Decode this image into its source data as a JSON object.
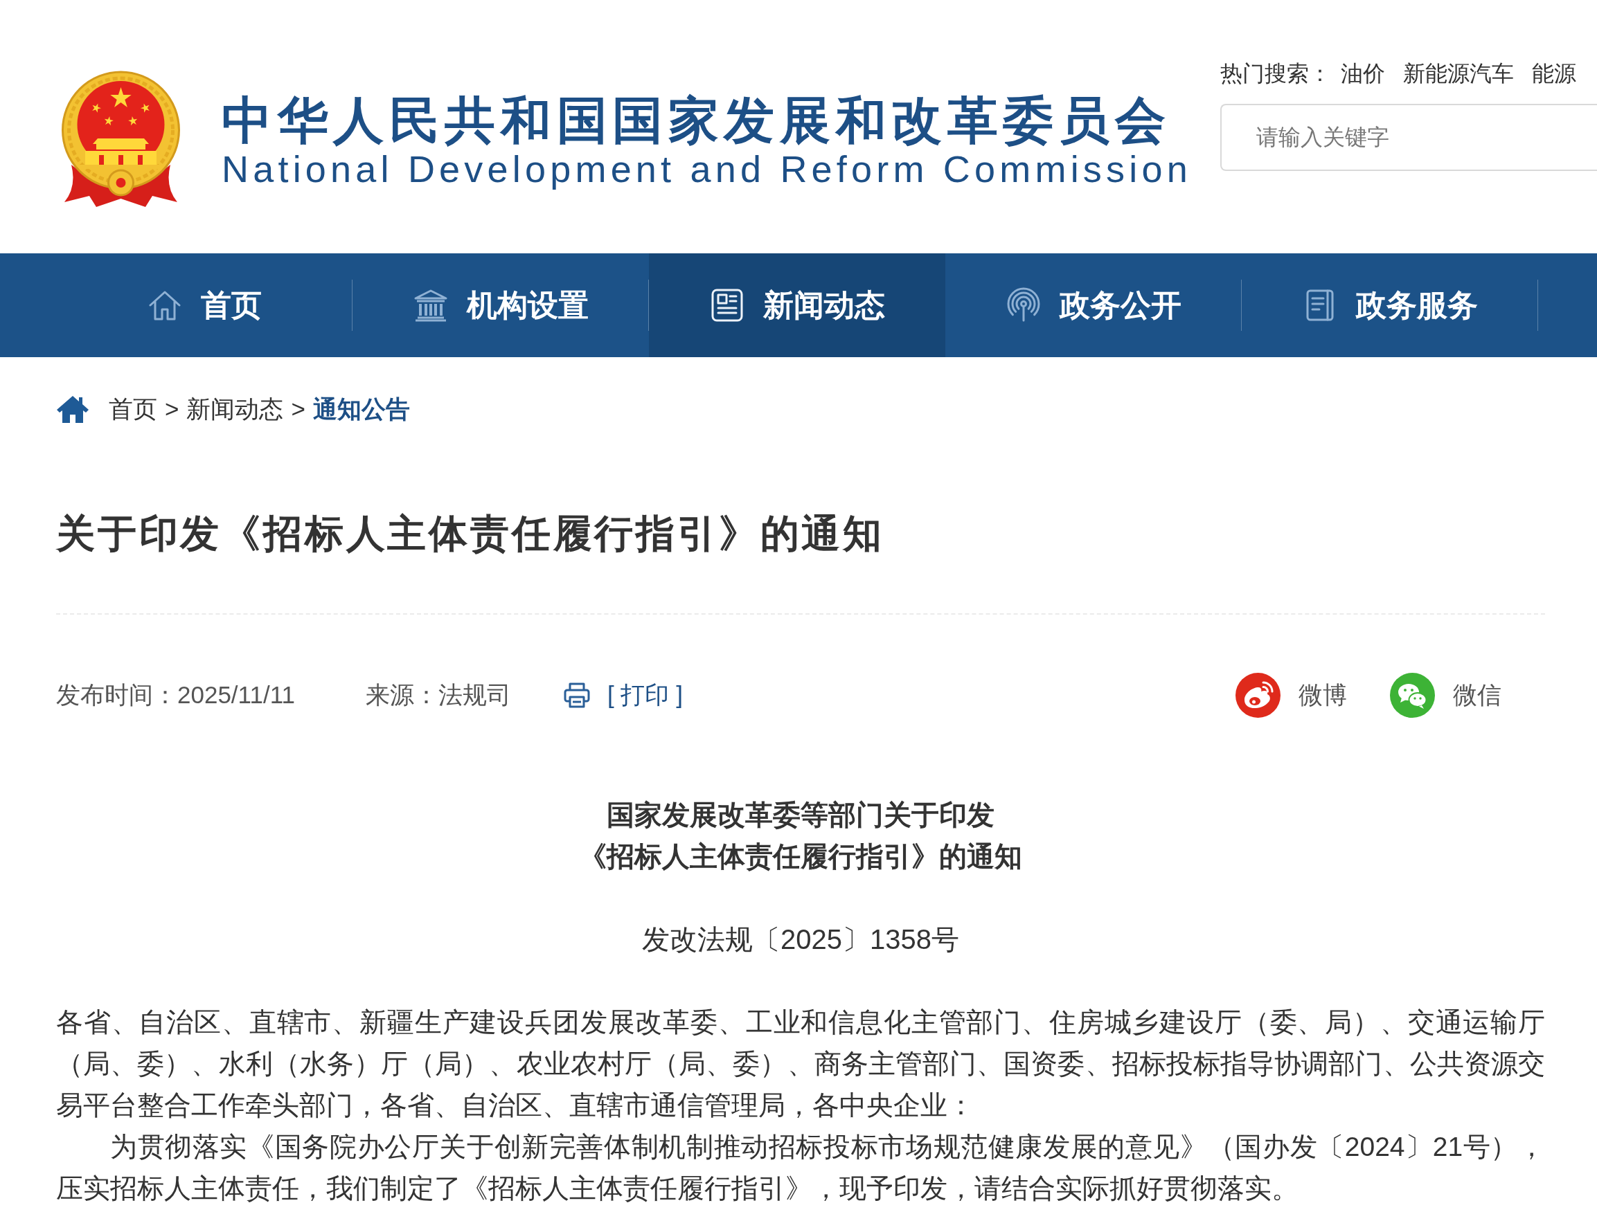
{
  "header": {
    "title": "中华人民共和国国家发展和改革委员会",
    "subtitle": "National Development and Reform Commission",
    "hot_search": {
      "label": "热门搜索：",
      "items": [
        "油价",
        "新能源汽车",
        "能源"
      ]
    },
    "search": {
      "placeholder": "请输入关键字"
    }
  },
  "nav": [
    {
      "label": "首页",
      "selected": false
    },
    {
      "label": "机构设置",
      "selected": false
    },
    {
      "label": "新闻动态",
      "selected": true
    },
    {
      "label": "政务公开",
      "selected": false
    },
    {
      "label": "政务服务",
      "selected": false
    }
  ],
  "breadcrumb": [
    {
      "label": "首页",
      "separator": ">",
      "selected": false
    },
    {
      "label": "新闻动态",
      "separator": ">",
      "selected": false
    },
    {
      "label": "通知公告",
      "selected": true
    }
  ],
  "article": {
    "title": "关于印发《招标人主体责任履行指引》的通知",
    "published": "发布时间：2025/11/11",
    "source": "来源：法规司",
    "print": "[ 打印 ]",
    "share": [
      {
        "label": "微博",
        "color": "#df2a1b"
      },
      {
        "label": "微信",
        "color": "#3db336"
      }
    ],
    "heading": [
      "国家发展改革委等部门关于印发",
      "《招标人主体责任履行指引》的通知"
    ],
    "doc_number": "发改法规〔2025〕1358号",
    "paragraphs": [
      {
        "kind": "salutation",
        "text": "各省、自治区、直辖市、新疆生产建设兵团发展改革委、工业和信息化主管部门、住房城乡建设厅（委、局）、交通运输厅（局、委）、水利（水务）厅（局）、农业农村厅（局、委）、商务主管部门、国资委、招标投标指导协调部门、公共资源交易平台整合工作牵头部门，各省、自治区、直辖市通信管理局，各中央企业："
      },
      {
        "kind": "body",
        "text": "为贯彻落实《国务院办公厅关于创新完善体制机制推动招标投标市场规范健康发展的意见》（国办发〔2024〕21号），压实招标人主体责任，我们制定了《招标人主体责任履行指引》，现予印发，请结合实际抓好贯彻落实。"
      }
    ]
  }
}
